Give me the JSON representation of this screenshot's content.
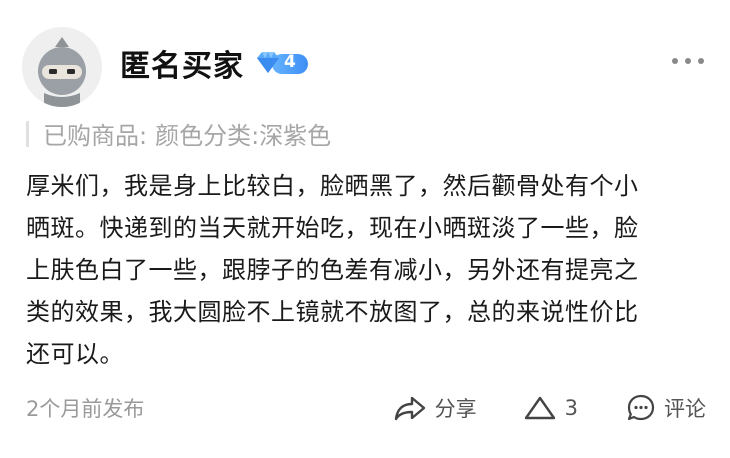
{
  "user": {
    "name": "匿名买家",
    "level": "4"
  },
  "purchase": {
    "label": "已购商品:",
    "spec_label": "颜色分类:",
    "spec_value": "深紫色"
  },
  "review": {
    "lines": [
      "厚米们，我是身上比较白，脸晒黑了，然后颧骨处有个小",
      "晒斑。快递到的当天就开始吃，现在小晒斑淡了一些，脸",
      "上肤色白了一些，跟脖子的色差有减小，另外还有提亮之",
      "类的效果，我大圆脸不上镜就不放图了，总的来说性价比",
      "还可以。"
    ]
  },
  "footer": {
    "time": "2个月前发布",
    "share_label": "分享",
    "like_count": "3",
    "comment_label": "评论"
  },
  "colors": {
    "badge": "#4a9cf7",
    "muted": "#a6a6a6"
  },
  "icons": {
    "avatar": "ninja-avatar",
    "level": "diamond-icon",
    "more": "more-dots-icon",
    "share": "share-arrow-icon",
    "like": "triangle-like-icon",
    "comment": "comment-bubble-icon"
  }
}
